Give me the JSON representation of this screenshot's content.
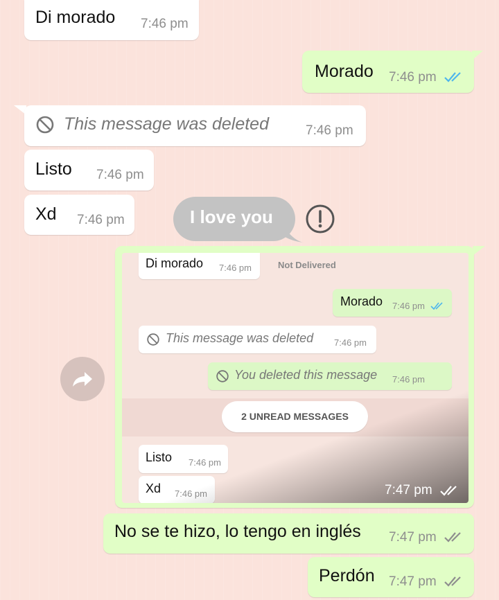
{
  "messages": [
    {
      "text": "Di morado",
      "time": "7:46 pm"
    },
    {
      "text": "Morado",
      "time": "7:46 pm"
    },
    {
      "text": "This message was deleted",
      "time": "7:46 pm"
    },
    {
      "text": "Listo",
      "time": "7:46 pm"
    },
    {
      "text": "Xd",
      "time": "7:46 pm"
    },
    {
      "text": "No se te hizo, lo tengo en inglés",
      "time": "7:47 pm"
    },
    {
      "text": "Perdón",
      "time": "7:47 pm"
    }
  ],
  "sticker": {
    "text": "I love you",
    "status": "Not Delivered"
  },
  "forwarded": {
    "time": "7:47 pm",
    "items": [
      {
        "text": "Di morado",
        "time": "7:46 pm"
      },
      {
        "text": "Morado",
        "time": "7:46 pm"
      },
      {
        "text": "This message was deleted",
        "time": "7:46 pm"
      },
      {
        "text": "You deleted this message",
        "time": "7:46 pm"
      },
      {
        "text": "Listo",
        "time": "7:46 pm"
      },
      {
        "text": "Xd",
        "time": "7:46 pm"
      }
    ],
    "unread": "2 UNREAD MESSAGES"
  },
  "colors": {
    "background": "#fbe3dc",
    "incoming": "#ffffff",
    "outgoing": "#e1fec6",
    "read_ticks": "#4fb6ec",
    "sent_ticks": "#8e8e8e"
  },
  "icons": [
    "block-icon",
    "double-check-icon",
    "forward-icon",
    "alert-icon"
  ]
}
